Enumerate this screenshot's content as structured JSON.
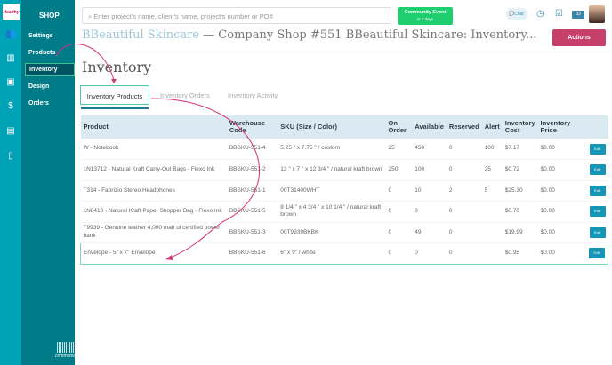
{
  "logo": "Healthy",
  "rail_icons": [
    "users-icon",
    "chart-icon",
    "calendar-icon",
    "dollar-icon",
    "building-icon",
    "book-icon"
  ],
  "nav": {
    "title": "SHOP",
    "items": [
      "Settings",
      "Products",
      "Inventory",
      "Design",
      "Orders"
    ],
    "footer": "commonsku"
  },
  "search": {
    "placeholder": "Enter project's name, client's name, project's number or PO#"
  },
  "event": {
    "label": "Community Event",
    "sub": "in 2 days"
  },
  "chat": "Chat",
  "badge": "33",
  "header": {
    "client": "BBeautiful Skincare",
    "title": " — Company Shop #551 BBeautiful Skincare: Inventory..."
  },
  "actions": "Actions",
  "page_title": "Inventory",
  "tabs": [
    "Inventory Products",
    "Inventory Orders",
    "Inventory Activity"
  ],
  "table": {
    "headers": [
      "Product",
      "Warehouse Code",
      "SKU (Size / Color)",
      "On Order",
      "Available",
      "Reserved",
      "Alert",
      "Inventory Cost",
      "Inventory Price",
      ""
    ],
    "edit_label": "Edit",
    "rows": [
      [
        "W - Notebook",
        "BBSKU-551-4",
        "5.25 \" x 7.75 \" / custom",
        "25",
        "450",
        "0",
        "100",
        "$7.17",
        "$0.00"
      ],
      [
        "1N13712 - Natural Kraft Carry-Out Bags - Flexo Ink",
        "BBSKU-551-2",
        "13 \" x 7 \" x 12 3/4 \" / natural kraft brown",
        "250",
        "100",
        "0",
        "25",
        "$0.72",
        "$0.00"
      ],
      [
        "T314 - Fabrizio Stereo Headphones",
        "BBSKU-551-1",
        "00T31400WHT",
        "0",
        "10",
        "2",
        "5",
        "$25.30",
        "$0.00"
      ],
      [
        "1N8410 - Natural Kraft Paper Shopper Bag - Flexo Ink",
        "BBSKU-551-5",
        "8 1/4 \" x 4 3/4 \" x 10 1/4 \" / natural kraft brown",
        "0",
        "0",
        "0",
        "",
        "$0.70",
        "$0.00"
      ],
      [
        "T9939 - Genuine leather 4,000 mah ul certified power bank",
        "BBSKU-551-3",
        "00T9939BKBK",
        "0",
        "49",
        "0",
        "",
        "$19.99",
        "$0.00"
      ],
      [
        "Envelope - 5\" x 7\" Envelope",
        "BBSKU-551-6",
        "6\" x 9\" / white",
        "0",
        "0",
        "0",
        "",
        "$0.95",
        "$0.00"
      ]
    ]
  },
  "colors": {
    "rail": "#00a3b5",
    "nav": "#007c89",
    "actions": "#c7406c",
    "event": "#1fcf6f",
    "annotation": "#d6337a"
  }
}
